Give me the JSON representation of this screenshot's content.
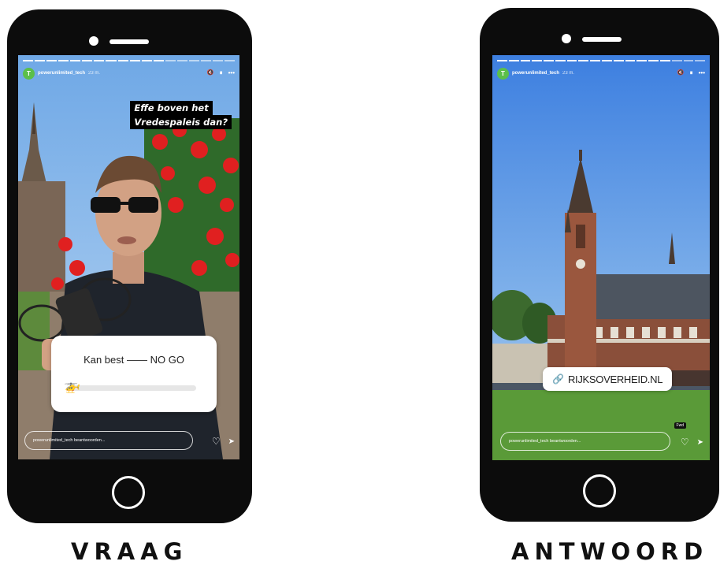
{
  "left_story": {
    "account_handle": "powerunlimited_tech",
    "time_ago": "23 m.",
    "question_line1": "Effe boven het",
    "question_line2": "Vredespaleis dan?",
    "slider_label": "Kan best —— NO GO",
    "slider_emoji": "🚁",
    "slider_level": 0.02,
    "reply_placeholder": "powerunlimited_tech beantwoorden...",
    "avatar_letter": "T",
    "icon_mute": "🔇",
    "icon_pause": "⏸",
    "icon_more": "•••",
    "icon_heart": "♡",
    "icon_send": "➤"
  },
  "right_story": {
    "account_handle": "powerunlimited_tech",
    "time_ago": "23 m.",
    "link_text": "RIJKSOVERHEID.NL",
    "link_icon": "🔗",
    "reply_placeholder": "powerunlimited_tech beantwoorden...",
    "tooltip": "Fwd",
    "avatar_letter": "T",
    "icon_mute": "🔇",
    "icon_pause": "⏸",
    "icon_more": "•••",
    "icon_heart": "♡",
    "icon_send": "➤"
  },
  "captions": {
    "left": "VRAAG",
    "right": "ANTWOORD"
  }
}
